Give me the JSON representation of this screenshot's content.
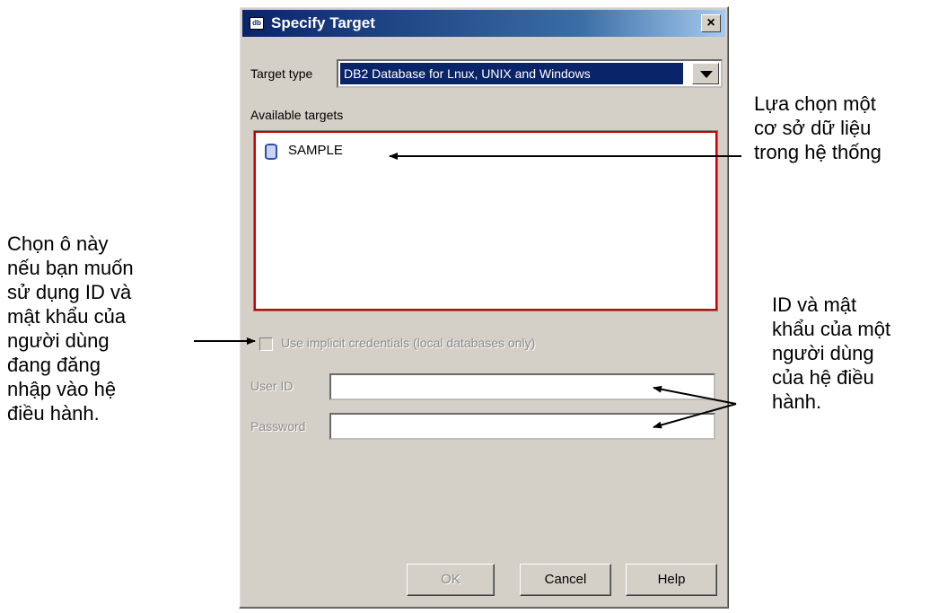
{
  "dialog": {
    "title": "Specify Target",
    "close_label": "×",
    "title_icon_text": "db",
    "target_type_label": "Target type",
    "target_type_value": "DB2 Database for Lnux, UNIX and Windows",
    "available_targets_label": "Available targets",
    "targets": [
      {
        "label": "SAMPLE",
        "icon": "database-icon"
      }
    ],
    "implicit_credentials_label": "Use implicit credentials (local databases only)",
    "userid_label": "User ID",
    "password_label": "Password",
    "userid_value": "",
    "password_value": "",
    "buttons": {
      "ok": "OK",
      "cancel": "Cancel",
      "help": "Help"
    }
  },
  "annotations": {
    "left": "Chọn ô này\nnếu bạn muốn\nsử dụng ID và\nmật khẩu của\nngười dùng\nđang đăng\nnhập vào hệ\nđiều hành.",
    "top_right": "Lựa chọn một\ncơ sở dữ liệu\ntrong hệ thống",
    "mid_right": "ID và mật\nkhẩu của một\nngười dùng\ncủa hệ điều\nhành."
  },
  "colors": {
    "title_bar": "#0a246a",
    "selection": "#0a246a",
    "list_highlight_border": "#cc0000",
    "dialog_face": "#d4d0c8"
  }
}
